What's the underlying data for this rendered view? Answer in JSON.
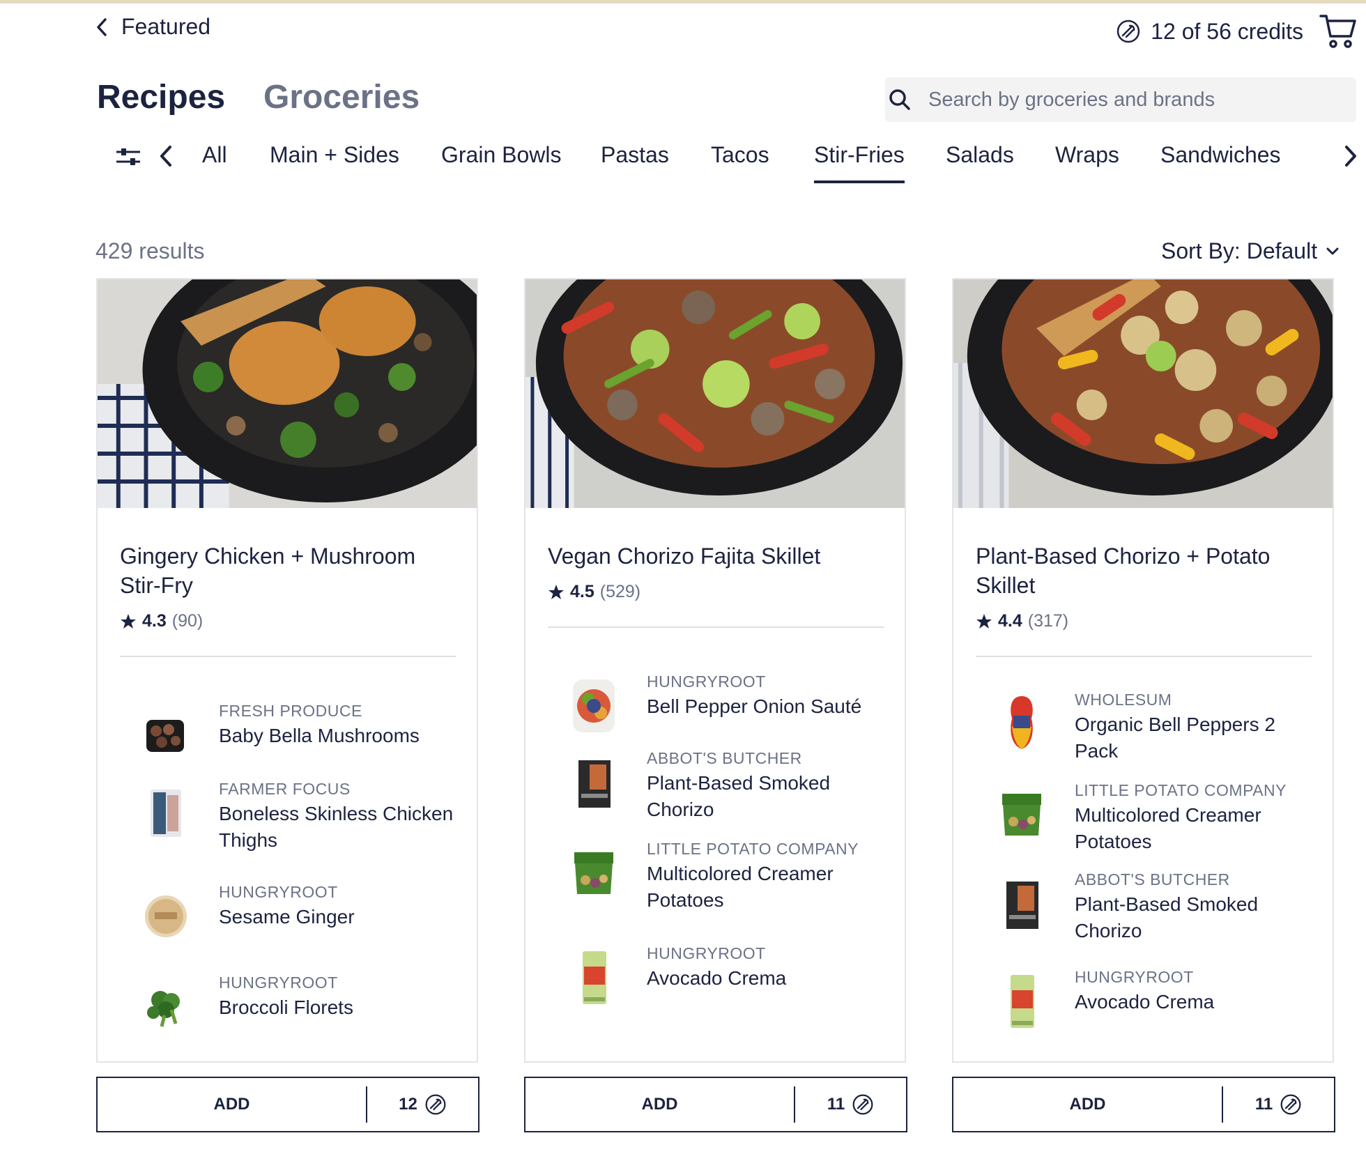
{
  "header": {
    "back_label": "Featured",
    "credits_text": "12 of 56 credits",
    "credit_icon": "credit-coin-icon",
    "cart_icon": "cart-icon"
  },
  "main_tabs": [
    "Recipes",
    "Groceries"
  ],
  "active_main_tab": "Recipes",
  "search": {
    "placeholder": "Search by groceries and brands",
    "icon": "search-icon"
  },
  "categories": [
    "All",
    "Main + Sides",
    "Grain Bowls",
    "Pastas",
    "Tacos",
    "Stir-Fries",
    "Salads",
    "Wraps",
    "Sandwiches"
  ],
  "active_category": "Stir-Fries",
  "results_text": "429 results",
  "sort_label": "Sort By: Default",
  "colors": {
    "text": "#1c2340",
    "muted": "#6b7287",
    "accent_top": "#e6dcc0"
  },
  "cards": [
    {
      "title": "Gingery Chicken + Mushroom Stir-Fry",
      "rating": "4.3",
      "rating_count": "(90)",
      "ingredients": [
        {
          "brand": "FRESH PRODUCE",
          "name": "Baby Bella Mushrooms"
        },
        {
          "brand": "FARMER FOCUS",
          "name": "Boneless Skinless Chicken Thighs"
        },
        {
          "brand": "HUNGRYROOT",
          "name": "Sesame Ginger"
        },
        {
          "brand": "HUNGRYROOT",
          "name": "Broccoli Florets"
        }
      ],
      "add_label": "ADD",
      "credit_cost": "12"
    },
    {
      "title": "Vegan Chorizo Fajita Skillet",
      "rating": "4.5",
      "rating_count": "(529)",
      "ingredients": [
        {
          "brand": "HUNGRYROOT",
          "name": "Bell Pepper Onion Sauté"
        },
        {
          "brand": "ABBOT'S BUTCHER",
          "name": "Plant-Based Smoked Chorizo"
        },
        {
          "brand": "LITTLE POTATO COMPANY",
          "name": "Multicolored Creamer Potatoes"
        },
        {
          "brand": "HUNGRYROOT",
          "name": "Avocado Crema"
        }
      ],
      "add_label": "ADD",
      "credit_cost": "11"
    },
    {
      "title": "Plant-Based Chorizo + Potato Skillet",
      "rating": "4.4",
      "rating_count": "(317)",
      "ingredients": [
        {
          "brand": "WHOLESUM",
          "name": "Organic Bell Peppers 2 Pack"
        },
        {
          "brand": "LITTLE POTATO COMPANY",
          "name": "Multicolored Creamer Potatoes"
        },
        {
          "brand": "ABBOT'S BUTCHER",
          "name": "Plant-Based Smoked Chorizo"
        },
        {
          "brand": "HUNGRYROOT",
          "name": "Avocado Crema"
        }
      ],
      "add_label": "ADD",
      "credit_cost": "11"
    }
  ]
}
